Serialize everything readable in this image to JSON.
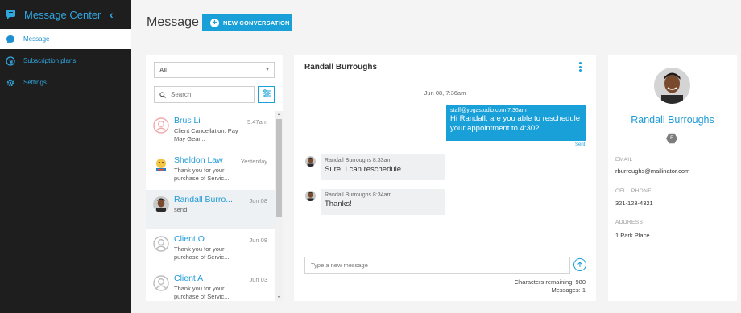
{
  "sidebar": {
    "title": "Message Center",
    "items": [
      {
        "label": "Message",
        "icon": "chat-bubble-icon"
      },
      {
        "label": "Subscription plans",
        "icon": "subscription-icon"
      },
      {
        "label": "Settings",
        "icon": "gear-icon"
      }
    ]
  },
  "header": {
    "title": "Message",
    "new_button": "NEW CONVERSATION"
  },
  "list": {
    "filter_value": "All",
    "search_placeholder": "Search",
    "conversations": [
      {
        "name": "Brus Li",
        "time": "5:47am",
        "preview": "Client Cancellation: Pay May Gear..."
      },
      {
        "name": "Sheldon Law",
        "time": "Yesterday",
        "preview": "Thank you for your purchase of Servic..."
      },
      {
        "name": "Randall Burro...",
        "time": "Jun 08",
        "preview": "send"
      },
      {
        "name": "Client O",
        "time": "Jun 08",
        "preview": "Thank you for your purchase of Servic..."
      },
      {
        "name": "Client A",
        "time": "Jun 03",
        "preview": "Thank you for your purchase of Servic..."
      }
    ]
  },
  "chat": {
    "title": "Randall Burroughs",
    "date_separator": "Jun 08, 7:36am",
    "outgoing": {
      "meta": "staff@yogastudio.com 7:36am",
      "text": "Hi Randall, are you able to reschedule your appointment to 4:30?",
      "status": "Sent"
    },
    "incoming": [
      {
        "meta": "Randall Burroughs 8:33am",
        "text": "Sure, I can reschedule"
      },
      {
        "meta": "Randall Burroughs 8:34am",
        "text": "Thanks!"
      }
    ],
    "composer_placeholder": "Type a new message",
    "chars_remaining": "Characters remaining: 980",
    "messages_count": "Messages: 1"
  },
  "contact": {
    "name": "Randall Burroughs",
    "badge": "F",
    "email_label": "EMAIL",
    "email": "rburroughs@mailinator.com",
    "phone_label": "CELL PHONE",
    "phone": "321-123-4321",
    "address_label": "ADDRESS",
    "address": "1 Park Place"
  },
  "colors": {
    "accent": "#1aa0d8",
    "sidebar_bg": "#1e1e1e"
  }
}
